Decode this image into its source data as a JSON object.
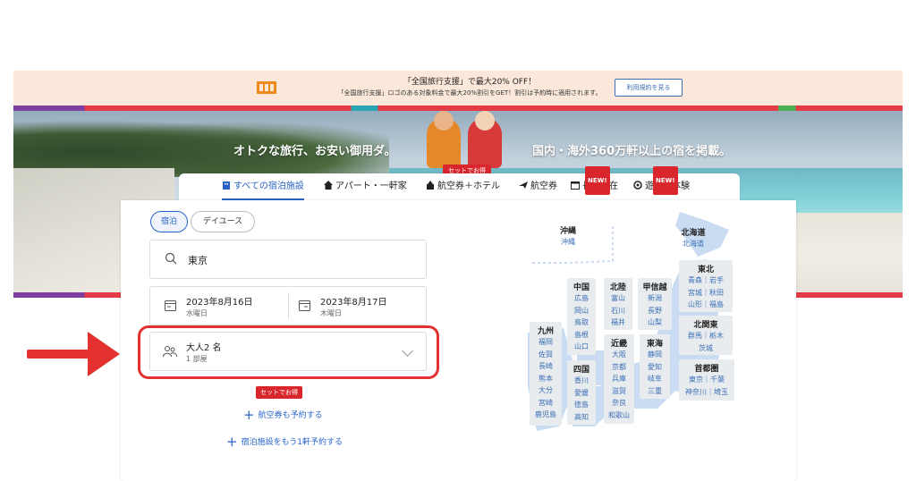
{
  "promo": {
    "title": "「全国旅行支援」で最大20% OFF！",
    "subtitle": "「全国旅行支援」ロゴのある対象料金で最大20%割引をGET！割引は予約時に適用されます。",
    "button": "利用規約を見る"
  },
  "hero": {
    "tagline_left": "オトクな旅行、お安い御用ダ。",
    "tagline_right": "国内・海外360万軒以上の宿を掲載。",
    "badge": "セットでお得"
  },
  "tabs": [
    {
      "label": "すべての宿泊施設",
      "active": true
    },
    {
      "label": "アパート・一軒家",
      "active": false
    },
    {
      "label": "航空券＋ホテル",
      "active": false
    },
    {
      "label": "航空券",
      "active": false
    },
    {
      "label": "長期滞在",
      "active": false,
      "badge": "NEW!"
    },
    {
      "label": "遊び・体験",
      "active": false,
      "badge": "NEW!"
    }
  ],
  "search": {
    "stay_type": {
      "selected": "宿泊",
      "other": "デイユース"
    },
    "destination": "東京",
    "checkin": {
      "date": "2023年8月16日",
      "weekday": "水曜日"
    },
    "checkout": {
      "date": "2023年8月17日",
      "weekday": "木曜日"
    },
    "guests": {
      "main": "大人2 名",
      "rooms": "1 部屋"
    },
    "set_tag": "セットでお得",
    "add_flight": "航空券も予約する",
    "add_hotel": "宿泊施設をもう1軒予約する"
  },
  "map": {
    "okinawa": {
      "name": "沖縄",
      "prefs": [
        "沖縄"
      ]
    },
    "hokkaido": {
      "name": "北海道",
      "prefs": [
        "北海道"
      ]
    },
    "tohoku": {
      "name": "東北",
      "prefs": [
        "青森｜岩手",
        "宮城｜秋田",
        "山形｜福島"
      ]
    },
    "kitakanto": {
      "name": "北関東",
      "prefs": [
        "群馬｜栃木",
        "茨城"
      ]
    },
    "shutoken": {
      "name": "首都圏",
      "prefs": [
        "東京｜千葉",
        "神奈川｜埼玉"
      ]
    },
    "koshinetsu": {
      "name": "甲信越",
      "prefs": [
        "新潟",
        "長野",
        "山梨"
      ]
    },
    "tokai": {
      "name": "東海",
      "prefs": [
        "静岡",
        "愛知",
        "岐阜",
        "三重"
      ]
    },
    "hokuriku": {
      "name": "北陸",
      "prefs": [
        "富山",
        "石川",
        "福井"
      ]
    },
    "kinki": {
      "name": "近畿",
      "prefs": [
        "大阪",
        "京都",
        "兵庫",
        "滋賀",
        "奈良",
        "和歌山"
      ]
    },
    "chugoku": {
      "name": "中国",
      "prefs": [
        "広島",
        "岡山",
        "鳥取",
        "島根",
        "山口"
      ]
    },
    "shikoku": {
      "name": "四国",
      "prefs": [
        "香川",
        "愛媛",
        "徳島",
        "高知"
      ]
    },
    "kyushu": {
      "name": "九州",
      "prefs": [
        "福岡",
        "佐賀",
        "長崎",
        "熊本",
        "大分",
        "宮崎",
        "鹿児島"
      ]
    }
  },
  "colors": {
    "accent": "#2864c7",
    "highlight": "#e2312e",
    "badge": "#d9262c"
  }
}
